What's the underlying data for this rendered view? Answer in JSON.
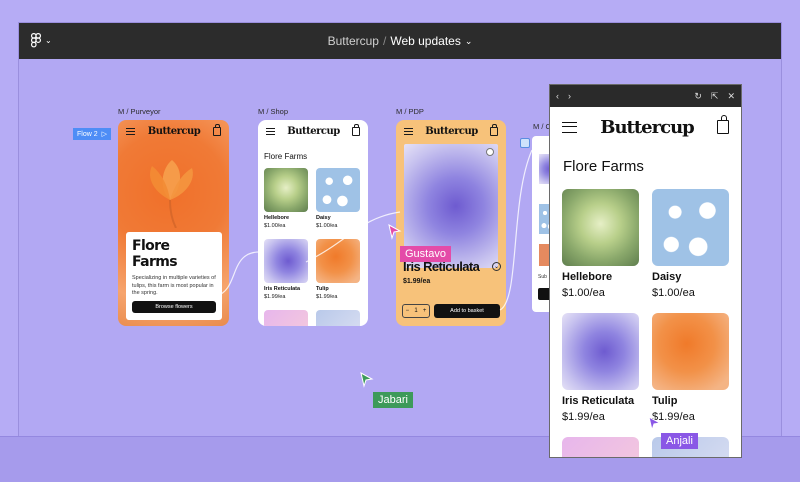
{
  "topbar": {
    "project": "Buttercup",
    "separator": "/",
    "file": "Web updates"
  },
  "frames": {
    "purveyor": {
      "label": "M / Purveyor",
      "brand": "Buttercup",
      "title": "Flore Farms",
      "desc": "Specializing in multiple varieties of tulips, this farm is most popular in the spring.",
      "button": "Browse flowers"
    },
    "shop": {
      "label": "M / Shop",
      "brand": "Buttercup",
      "section": "Flore Farms",
      "items": [
        {
          "name": "Hellebore",
          "price": "$1.00/ea"
        },
        {
          "name": "Daisy",
          "price": "$1.00/ea"
        },
        {
          "name": "Iris Reticulata",
          "price": "$1.99/ea"
        },
        {
          "name": "Tulip",
          "price": "$1.99/ea"
        }
      ]
    },
    "pdp": {
      "label": "M / PDP",
      "brand": "Buttercup",
      "title": "Iris Reticulata",
      "price": "$1.99/ea",
      "qty": "1",
      "button": "Add to basket"
    },
    "partial": {
      "label": "M / C",
      "price": "Sub"
    }
  },
  "flow": {
    "label": "Flow 2"
  },
  "preview": {
    "brand": "Buttercup",
    "section": "Flore Farms",
    "items": [
      {
        "name": "Hellebore",
        "price": "$1.00/ea"
      },
      {
        "name": "Daisy",
        "price": "$1.00/ea"
      },
      {
        "name": "Iris Reticulata",
        "price": "$1.99/ea"
      },
      {
        "name": "Tulip",
        "price": "$1.99/ea"
      }
    ]
  },
  "cursors": [
    {
      "name": "Gustavo",
      "color": "#e44ba8"
    },
    {
      "name": "Jabari",
      "color": "#3d9a5a"
    },
    {
      "name": "Anjali",
      "color": "#8a57e6"
    }
  ]
}
